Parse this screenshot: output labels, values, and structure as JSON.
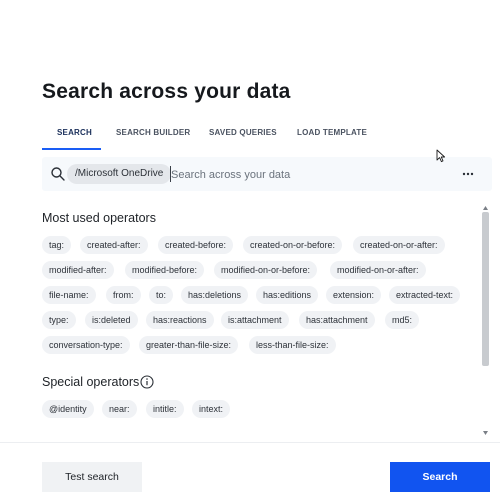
{
  "page": {
    "title": "Search across your data"
  },
  "tabs": [
    {
      "label": "SEARCH",
      "active": true
    },
    {
      "label": "SEARCH BUILDER",
      "active": false
    },
    {
      "label": "SAVED QUERIES",
      "active": false
    },
    {
      "label": "LOAD TEMPLATE",
      "active": false
    }
  ],
  "search": {
    "icon": "search-icon",
    "scope_chip": "/Microsoft OneDrive",
    "placeholder": "Search across your data",
    "value": "",
    "more_icon": "more-horizontal-icon"
  },
  "most_used": {
    "title": "Most used operators",
    "operators": [
      "tag:",
      "created-after:",
      "created-before:",
      "created-on-or-before:",
      "created-on-or-after:",
      "modified-after:",
      "modified-before:",
      "modified-on-or-before:",
      "modified-on-or-after:",
      "file-name:",
      "from:",
      "to:",
      "has:deletions",
      "has:editions",
      "extension:",
      "extracted-text:",
      "type:",
      "is:deleted",
      "has:reactions",
      "is:attachment",
      "has:attachment",
      "md5:",
      "conversation-type:",
      "greater-than-file-size:",
      "less-than-file-size:"
    ]
  },
  "special": {
    "title": "Special operators",
    "info_icon": "info-icon",
    "operators": [
      "@identity",
      "near:",
      "intitle:",
      "intext:"
    ]
  },
  "footer": {
    "test_label": "Test search",
    "search_label": "Search"
  },
  "colors": {
    "accent": "#1a5df5",
    "primary_button": "#1154f0",
    "chip_bg": "#f0f2f5",
    "search_bg": "#f6f9fc"
  }
}
